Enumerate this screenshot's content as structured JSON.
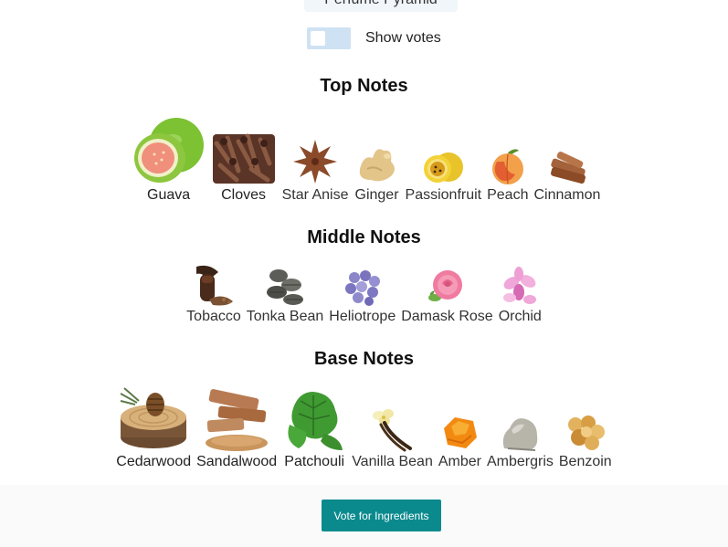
{
  "header": {
    "pyramid_label": "Perfume Pyramid"
  },
  "toggle": {
    "label": "Show votes"
  },
  "top_notes": {
    "title": "Top Notes",
    "items": [
      {
        "label": "Guava",
        "icon": "guava-icon"
      },
      {
        "label": "Cloves",
        "icon": "cloves-icon"
      },
      {
        "label": "Star Anise",
        "icon": "star-anise-icon"
      },
      {
        "label": "Ginger",
        "icon": "ginger-icon"
      },
      {
        "label": "Passionfruit",
        "icon": "passionfruit-icon"
      },
      {
        "label": "Peach",
        "icon": "peach-icon"
      },
      {
        "label": "Cinnamon",
        "icon": "cinnamon-icon"
      }
    ]
  },
  "middle_notes": {
    "title": "Middle Notes",
    "items": [
      {
        "label": "Tobacco",
        "icon": "tobacco-icon"
      },
      {
        "label": "Tonka Bean",
        "icon": "tonka-bean-icon"
      },
      {
        "label": "Heliotrope",
        "icon": "heliotrope-icon"
      },
      {
        "label": "Damask Rose",
        "icon": "damask-rose-icon"
      },
      {
        "label": "Orchid",
        "icon": "orchid-icon"
      }
    ]
  },
  "base_notes": {
    "title": "Base Notes",
    "items": [
      {
        "label": "Cedarwood",
        "icon": "cedarwood-icon"
      },
      {
        "label": "Sandalwood",
        "icon": "sandalwood-icon"
      },
      {
        "label": "Patchouli",
        "icon": "patchouli-icon"
      },
      {
        "label": "Vanilla Bean",
        "icon": "vanilla-bean-icon"
      },
      {
        "label": "Amber",
        "icon": "amber-icon"
      },
      {
        "label": "Ambergris",
        "icon": "ambergris-icon"
      },
      {
        "label": "Benzoin",
        "icon": "benzoin-icon"
      }
    ]
  },
  "footer": {
    "vote_button_label": "Vote for Ingredients"
  },
  "colors": {
    "accent": "#0b8a8e",
    "toggle_track": "#cfe2f3",
    "footer_bg": "#fafafa"
  }
}
